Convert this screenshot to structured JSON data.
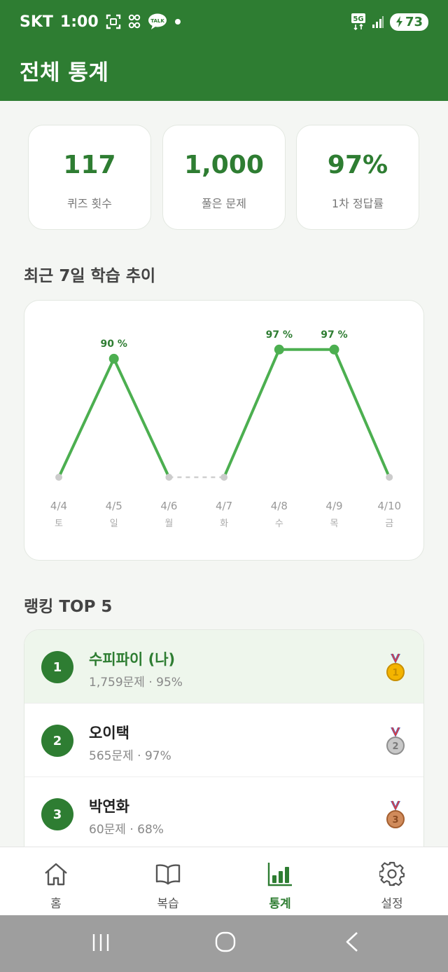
{
  "status_bar": {
    "carrier": "SKT",
    "time": "1:00",
    "talk_label": "TALK",
    "network": "5G",
    "battery": "73"
  },
  "header": {
    "title": "전체 통계"
  },
  "stats": [
    {
      "value": "117",
      "label": "퀴즈 횟수"
    },
    {
      "value": "1,000",
      "label": "풀은 문제"
    },
    {
      "value": "97%",
      "label": "1차 정답률"
    }
  ],
  "trend_section": {
    "title": "최근 7일 학습 추이"
  },
  "chart_data": {
    "type": "line",
    "categories": [
      "4/4",
      "4/5",
      "4/6",
      "4/7",
      "4/8",
      "4/9",
      "4/10"
    ],
    "weekdays": [
      "토",
      "일",
      "월",
      "화",
      "수",
      "목",
      "금"
    ],
    "values": [
      null,
      90,
      null,
      null,
      97,
      97,
      null
    ],
    "data_labels": [
      "",
      "90 %",
      "",
      "",
      "97 %",
      "97 %",
      ""
    ],
    "ylim": [
      0,
      100
    ],
    "grid": false,
    "colors": {
      "line": "#4caf50",
      "point": "#4caf50",
      "empty_point": "#cccccc",
      "label": "#2e7d32"
    }
  },
  "ranking_section": {
    "title": "랭킹 TOP 5"
  },
  "ranking": [
    {
      "rank": "1",
      "name": "수피파이 (나)",
      "detail": "1,759문제 · 95%",
      "medal": "gold-medal-icon",
      "medal_color": "#f4b400",
      "is_me": true
    },
    {
      "rank": "2",
      "name": "오이택",
      "detail": "565문제 · 97%",
      "medal": "silver-medal-icon",
      "medal_color": "#b0b0b0",
      "is_me": false
    },
    {
      "rank": "3",
      "name": "박연화",
      "detail": "60문제 · 68%",
      "medal": "bronze-medal-icon",
      "medal_color": "#c97b4a",
      "is_me": false
    }
  ],
  "bottom_nav": [
    {
      "label": "홈",
      "icon": "home-icon",
      "active": false
    },
    {
      "label": "복습",
      "icon": "book-icon",
      "active": false
    },
    {
      "label": "통계",
      "icon": "bar-chart-icon",
      "active": true
    },
    {
      "label": "설정",
      "icon": "gear-icon",
      "active": false
    }
  ],
  "colors": {
    "primary": "#2e7d32",
    "accent": "#4caf50",
    "background": "#f4f6f3"
  }
}
